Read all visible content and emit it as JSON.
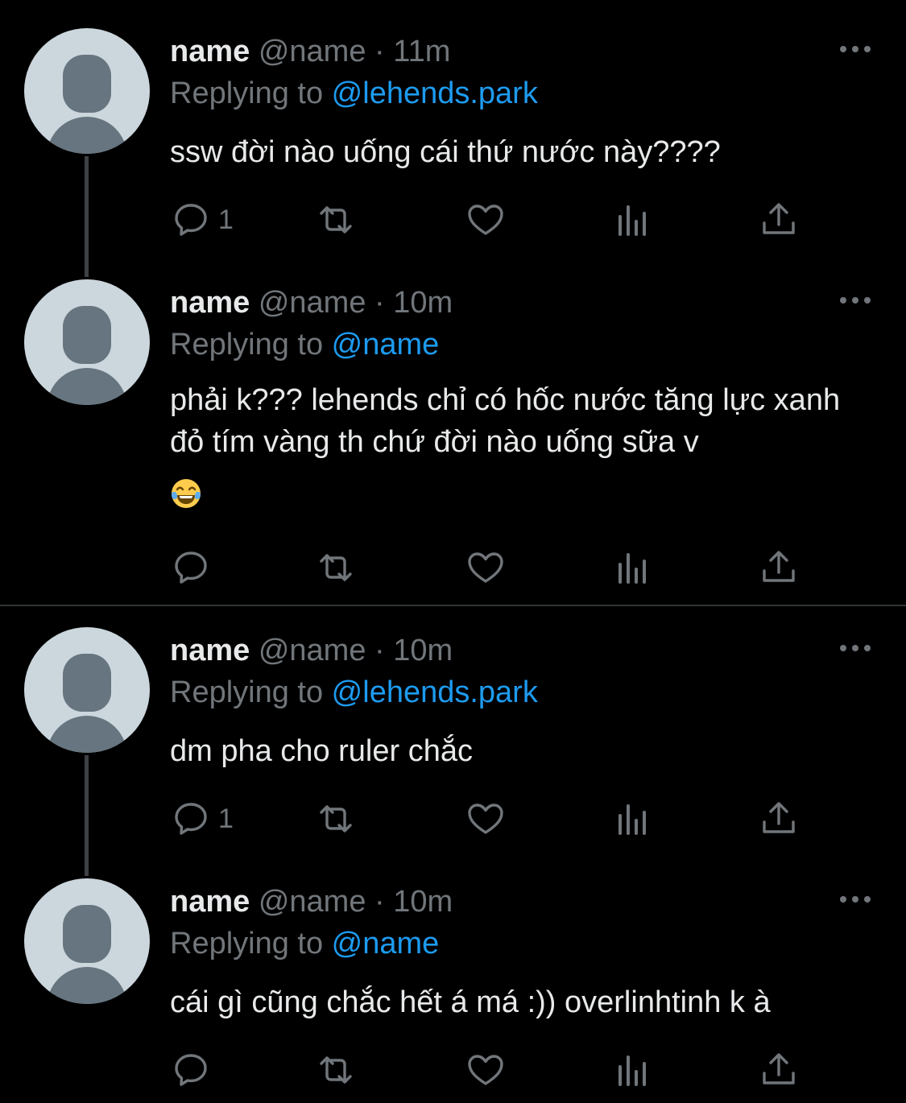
{
  "colors": {
    "background": "#000000",
    "text": "#e7e9ea",
    "muted": "#71767b",
    "link": "#1d9bf0",
    "avatar_bg": "#ccd6dd",
    "avatar_fg": "#66757f",
    "thread_line": "#3e4144"
  },
  "tweets": [
    {
      "name": "name",
      "handle": "@name",
      "separator": "·",
      "time": "11m",
      "replying_prefix": "Replying to ",
      "replying_to": "@lehends.park",
      "text": "ssw đời nào uống cái thứ nước này????",
      "reply_count": "1",
      "icons": [
        "reply-icon",
        "retweet-icon",
        "like-icon",
        "analytics-icon",
        "share-icon",
        "more-icon"
      ]
    },
    {
      "name": "name",
      "handle": "@name",
      "separator": "·",
      "time": "10m",
      "replying_prefix": "Replying to ",
      "replying_to": "@name",
      "text": "phải k??? lehends chỉ có hốc nước tăng lực xanh đỏ tím vàng th chứ đời nào uống sữa v",
      "emoji": "laughing-tears-emoji",
      "reply_count": "",
      "icons": [
        "reply-icon",
        "retweet-icon",
        "like-icon",
        "analytics-icon",
        "share-icon",
        "more-icon"
      ]
    },
    {
      "name": "name",
      "handle": "@name",
      "separator": "·",
      "time": "10m",
      "replying_prefix": "Replying to ",
      "replying_to": "@lehends.park",
      "text": "dm pha cho ruler chắc",
      "reply_count": "1",
      "icons": [
        "reply-icon",
        "retweet-icon",
        "like-icon",
        "analytics-icon",
        "share-icon",
        "more-icon"
      ]
    },
    {
      "name": "name",
      "handle": "@name",
      "separator": "·",
      "time": "10m",
      "replying_prefix": "Replying to ",
      "replying_to": "@name",
      "text": "cái gì cũng chắc hết á má :)) overlinhtinh k à",
      "reply_count": "",
      "icons": [
        "reply-icon",
        "retweet-icon",
        "like-icon",
        "analytics-icon",
        "share-icon",
        "more-icon"
      ]
    }
  ]
}
